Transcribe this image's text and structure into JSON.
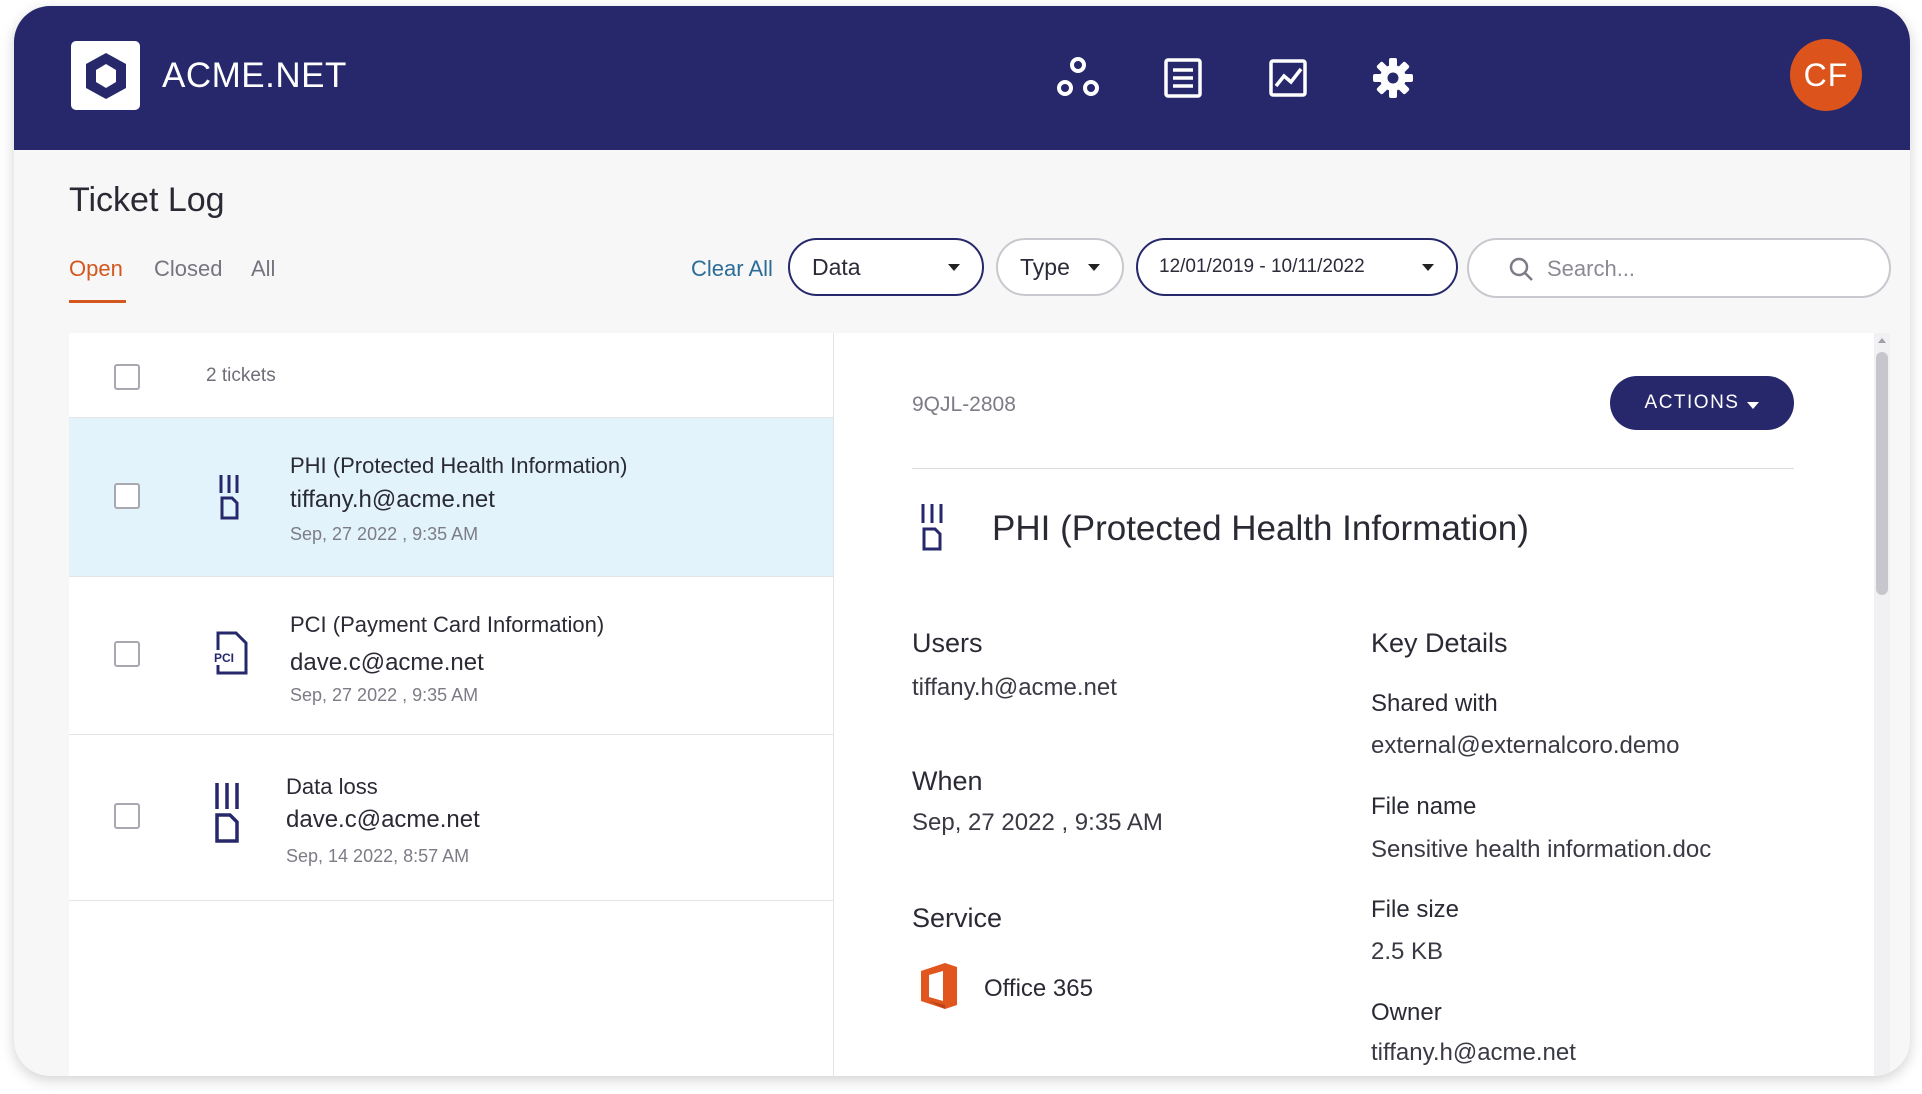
{
  "app": {
    "brand": "ACME.NET",
    "avatar_initials": "CF"
  },
  "nav_icons": [
    "nodes-icon",
    "list-document-icon",
    "chart-icon",
    "gear-icon"
  ],
  "page": {
    "title": "Ticket Log",
    "tabs": [
      {
        "label": "Open",
        "active": true
      },
      {
        "label": "Closed",
        "active": false
      },
      {
        "label": "All",
        "active": false
      }
    ]
  },
  "filters": {
    "clear_all": "Clear All",
    "data": "Data",
    "type": "Type",
    "date_range": "12/01/2019 - 10/11/2022",
    "search_placeholder": "Search..."
  },
  "list": {
    "count_label": "2 tickets",
    "tickets": [
      {
        "title": "PHI (Protected Health Information)",
        "user": "tiffany.h@acme.net",
        "date": "Sep, 27 2022 , 9:35 AM",
        "icon": "phi-document-icon",
        "selected": true
      },
      {
        "title": "PCI (Payment Card Information)",
        "user": "dave.c@acme.net",
        "date": "Sep, 27 2022 , 9:35 AM",
        "icon": "pci-document-icon",
        "selected": false
      },
      {
        "title": "Data loss",
        "user": "dave.c@acme.net",
        "date": "Sep, 14 2022, 8:57 AM",
        "icon": "data-loss-document-icon",
        "selected": false
      }
    ]
  },
  "detail": {
    "ticket_id": "9QJL-2808",
    "actions_label": "ACTIONS",
    "title": "PHI (Protected Health Information)",
    "users_label": "Users",
    "users_value": "tiffany.h@acme.net",
    "when_label": "When",
    "when_value": "Sep, 27 2022 , 9:35 AM",
    "service_label": "Service",
    "service_value": "Office 365",
    "key_details_label": "Key Details",
    "shared_with_label": "Shared with",
    "shared_with_value": "external@externalcoro.demo",
    "file_name_label": "File name",
    "file_name_value": "Sensitive health information.doc",
    "file_size_label": "File size",
    "file_size_value": "2.5 KB",
    "owner_label": "Owner",
    "owner_value": "tiffany.h@acme.net"
  },
  "colors": {
    "header_bg": "#26286b",
    "accent_orange": "#d4571e",
    "link_blue": "#2c6d98",
    "selected_row": "#e3f3fb",
    "office_orange": "#e1561f"
  }
}
